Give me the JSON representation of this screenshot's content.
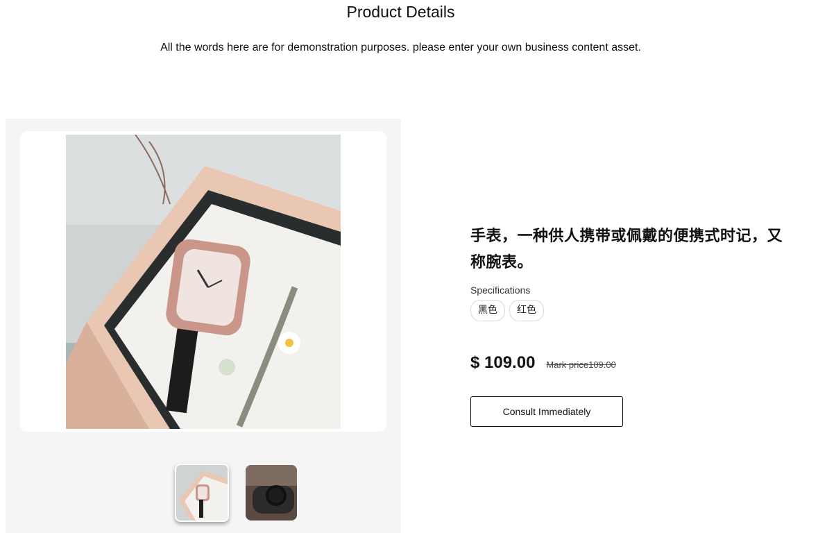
{
  "header": {
    "title": "Product Details",
    "subtitle": "All the words here are for demonstration purposes. please enter your own business content asset."
  },
  "gallery": {
    "thumbnails": [
      {
        "name": "watch-in-box",
        "active": true
      },
      {
        "name": "watch-on-wrist",
        "active": false
      }
    ]
  },
  "product": {
    "title": "手表，一种供人携带或佩戴的便携式时记，又称腕表。",
    "spec_label": "Specifications",
    "spec_options": [
      "黑色",
      "红色"
    ],
    "price": "$ 109.00",
    "mark_price": "Mark price109.00",
    "consult_label": "Consult Immediately"
  },
  "colors": {
    "gallery_bg": "#f5f5f5",
    "text": "#111111",
    "chip_border": "#d8d8d8"
  }
}
